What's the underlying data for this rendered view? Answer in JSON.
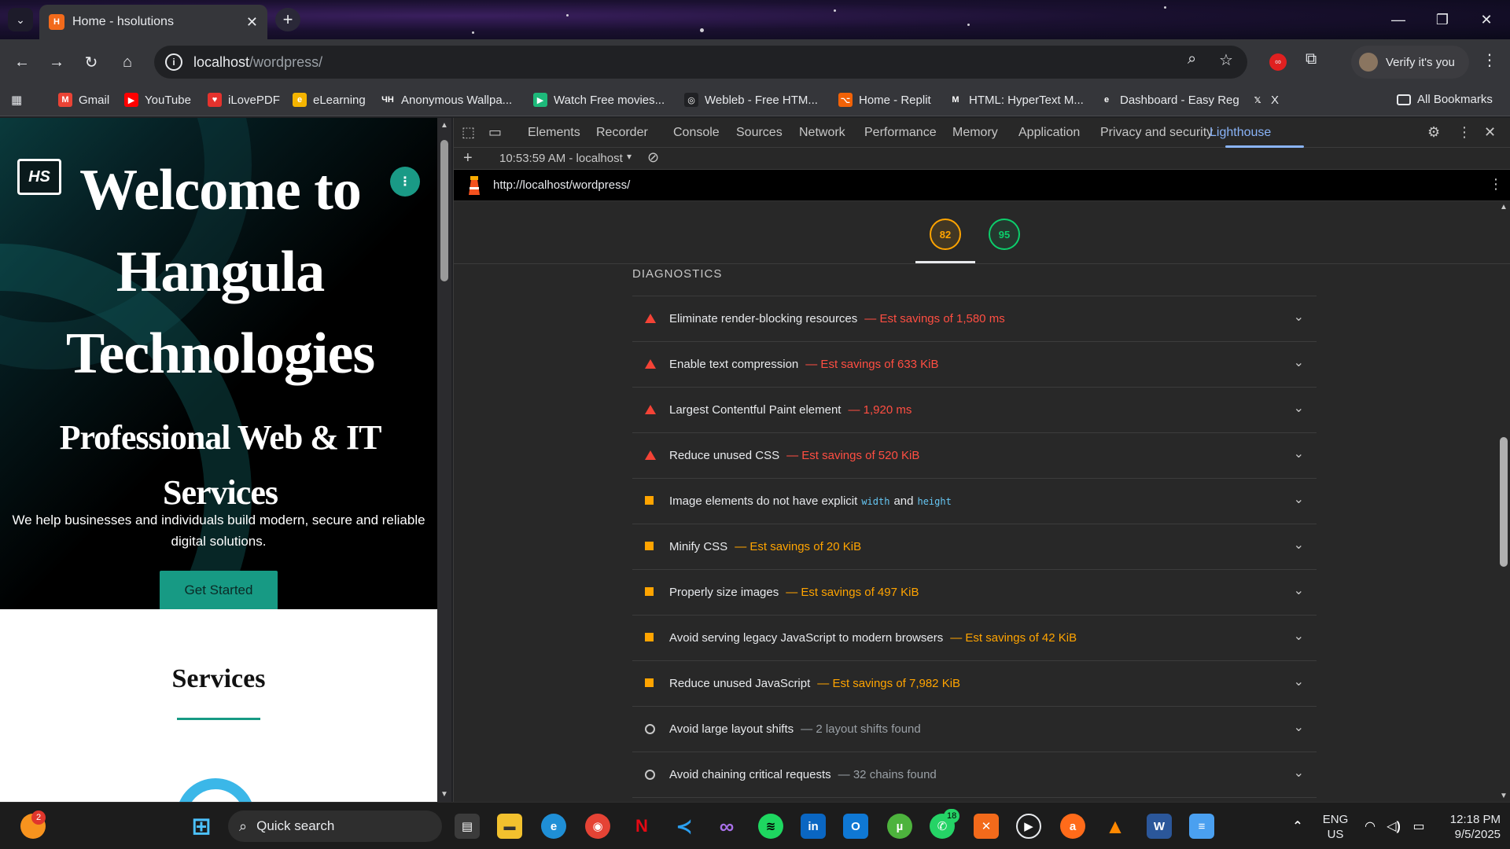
{
  "browser": {
    "tab_title": "Home - hsolutions",
    "tab_favicon_text": "H",
    "url_host": "localhost",
    "url_path": "/wordpress/",
    "profile_label": "Verify it's you",
    "bookmarks": [
      {
        "label": "Gmail",
        "icon": "gmail-icon",
        "color": "#ea4335",
        "glyph": "M"
      },
      {
        "label": "YouTube",
        "icon": "youtube-icon",
        "color": "#ff0000",
        "glyph": "▶"
      },
      {
        "label": "iLovePDF",
        "icon": "ilovepdf-icon",
        "color": "#e5322d",
        "glyph": "♥"
      },
      {
        "label": "eLearning",
        "icon": "elearning-icon",
        "color": "#f4b400",
        "glyph": "e"
      },
      {
        "label": "Anonymous Wallpa...",
        "icon": "wallpaper-icon",
        "color": "#35363a",
        "glyph": "ЧН"
      },
      {
        "label": "Watch Free movies...",
        "icon": "movies-icon",
        "color": "#1db97a",
        "glyph": "▶"
      },
      {
        "label": "Webleb - Free HTM...",
        "icon": "webleb-icon",
        "color": "#202124",
        "glyph": "◎"
      },
      {
        "label": "Home - Replit",
        "icon": "replit-icon",
        "color": "#f26207",
        "glyph": "⌥"
      },
      {
        "label": "HTML: HyperText M...",
        "icon": "mdn-icon",
        "color": "#35363a",
        "glyph": "M"
      },
      {
        "label": "Dashboard - Easy Reg",
        "icon": "easyreg-icon",
        "color": "#35363a",
        "glyph": "e"
      },
      {
        "label": "X",
        "icon": "x-icon",
        "color": "#35363a",
        "glyph": "𝕏"
      }
    ],
    "all_bookmarks_label": "All Bookmarks"
  },
  "site": {
    "logo_text": "HS",
    "hero_title_lines": [
      "Welcome to",
      "Hangula",
      "Technologies"
    ],
    "hero_subtitle_lines": [
      "Professional Web & IT",
      "Services"
    ],
    "hero_lead_lines": [
      "We help businesses and individuals build modern, secure and reliable",
      "digital solutions."
    ],
    "cta_label": "Get Started",
    "services_heading": "Services"
  },
  "devtools": {
    "tabs": [
      "Elements",
      "Recorder",
      "Console",
      "Sources",
      "Network",
      "Performance",
      "Memory",
      "Application",
      "Privacy and security",
      "Lighthouse"
    ],
    "active_tab": "Lighthouse",
    "report_selector": "10:53:59 AM - localhost",
    "report_url": "http://localhost/wordpress/",
    "scores": [
      {
        "value": "82",
        "color": "#ffa400"
      },
      {
        "value": "95",
        "color": "#0cce6b"
      }
    ],
    "diagnostics_heading": "DIAGNOSTICS",
    "audits": [
      {
        "severity": "fail",
        "title": "Eliminate render-blocking resources",
        "detail": "— Est savings of 1,580 ms"
      },
      {
        "severity": "fail",
        "title": "Enable text compression",
        "detail": "— Est savings of 633 KiB"
      },
      {
        "severity": "fail",
        "title": "Largest Contentful Paint element",
        "detail": "— 1,920 ms"
      },
      {
        "severity": "fail",
        "title": "Reduce unused CSS",
        "detail": "— Est savings of 520 KiB"
      },
      {
        "severity": "average",
        "title": "Image elements do not have explicit",
        "code1": "width",
        "mid": "and",
        "code2": "height",
        "detail": ""
      },
      {
        "severity": "average",
        "title": "Minify CSS",
        "detail": "— Est savings of 20 KiB"
      },
      {
        "severity": "average",
        "title": "Properly size images",
        "detail": "— Est savings of 497 KiB"
      },
      {
        "severity": "average",
        "title": "Avoid serving legacy JavaScript to modern browsers",
        "detail": "— Est savings of 42 KiB"
      },
      {
        "severity": "average",
        "title": "Reduce unused JavaScript",
        "detail": "— Est savings of 7,982 KiB"
      },
      {
        "severity": "info",
        "title": "Avoid large layout shifts",
        "detail": "— 2 layout shifts found"
      },
      {
        "severity": "info",
        "title": "Avoid chaining critical requests",
        "detail": "— 32 chains found"
      }
    ]
  },
  "taskbar": {
    "search_placeholder": "Quick search",
    "notification_badge": "2",
    "whatsapp_badge": "18",
    "language_line1": "ENG",
    "language_line2": "US",
    "time": "12:18 PM",
    "date": "9/5/2025"
  },
  "colors": {
    "accent_teal": "#179a84",
    "fail_red": "#ff4e42",
    "average_orange": "#ffa400",
    "pass_green": "#0cce6b",
    "devtools_blue": "#8ab4f8"
  }
}
